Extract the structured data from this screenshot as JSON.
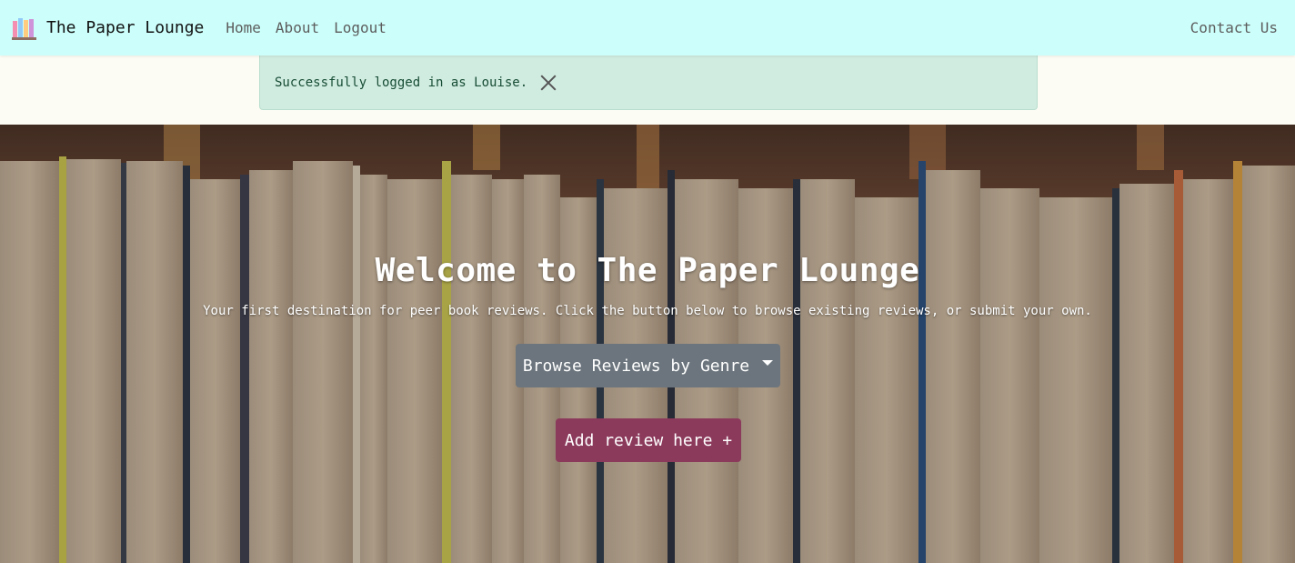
{
  "navbar": {
    "brand": "The Paper Lounge",
    "links": [
      "Home",
      "About",
      "Logout"
    ],
    "contact": "Contact Us",
    "logo_icon": "books-icon"
  },
  "alert": {
    "message": "Successfully logged in as Louise.",
    "close_icon": "close-icon"
  },
  "hero": {
    "title": "Welcome to The Paper Lounge",
    "subtitle": "Your first destination for peer book reviews. Click the button below to browse existing reviews, or submit your own.",
    "browse_label": "Browse Reviews by Genre",
    "add_label": "Add review here +"
  },
  "colors": {
    "navbar_bg": "#ccfffb",
    "alert_bg": "#d0ebe0",
    "browse_btn": "#6c757d",
    "add_btn": "#8c3a5c"
  }
}
